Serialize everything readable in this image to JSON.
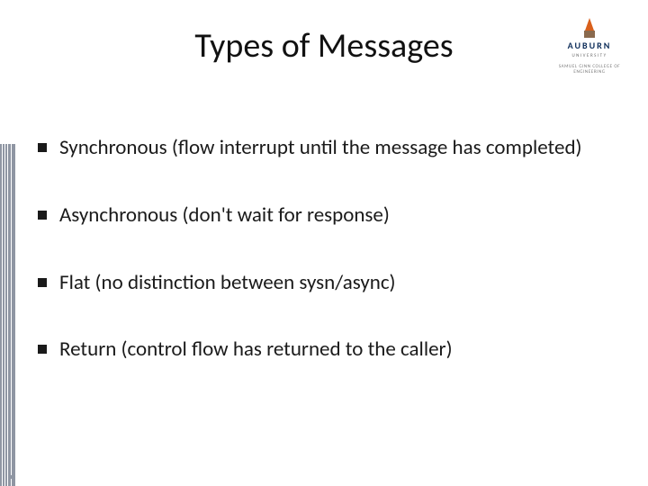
{
  "title": "Types of Messages",
  "logo": {
    "wordmark": "AUBURN",
    "subline": "UNIVERSITY",
    "college": "SAMUEL GINN COLLEGE OF ENGINEERING"
  },
  "bullets": [
    "Synchronous (flow interrupt until the message has completed)",
    "Asynchronous (don't wait for response)",
    "Flat (no distinction between sysn/async)",
    "Return (control flow has returned to the caller)"
  ]
}
